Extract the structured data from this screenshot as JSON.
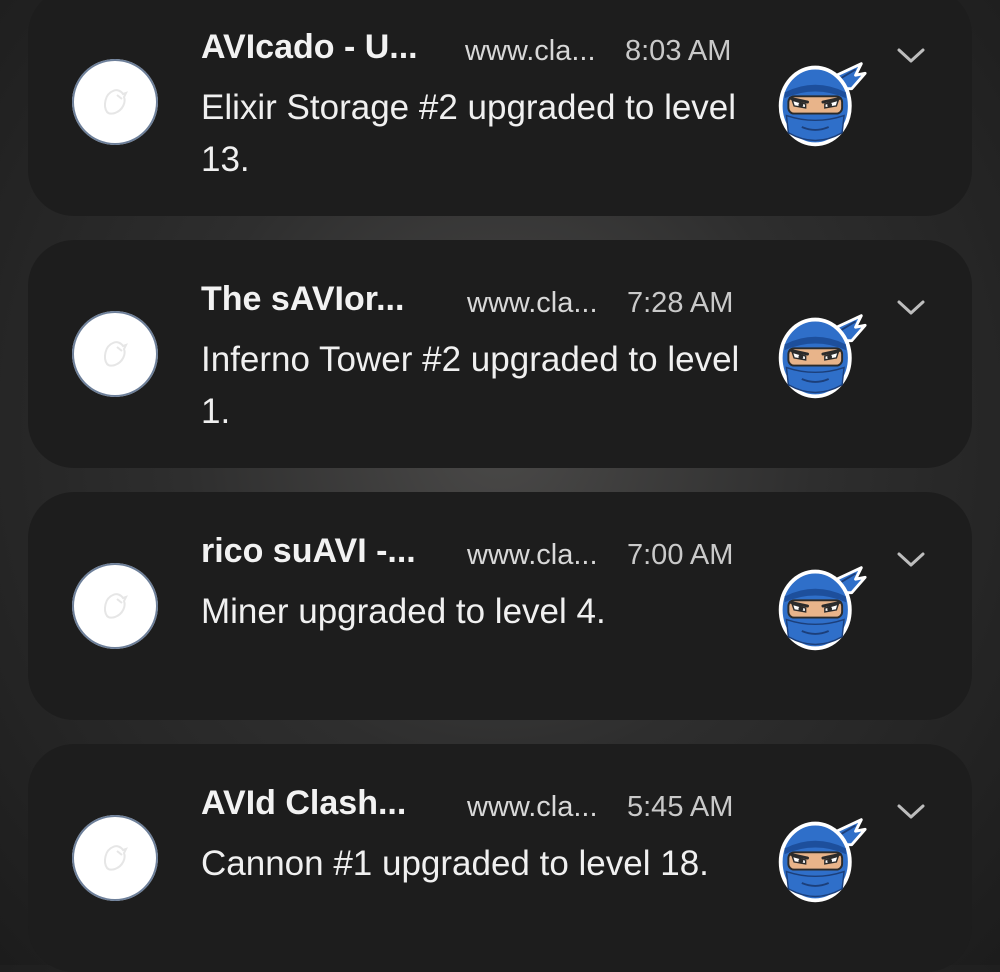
{
  "notifications": [
    {
      "title": "AVIcado - U...",
      "domain": "www.cla...",
      "time": "8:03 AM",
      "message": "Elixir Storage #2 upgraded to level 13.",
      "app_icon": "clash-app-icon",
      "large_icon": "blue-ninja-icon",
      "action_icon": "chevron-down-icon"
    },
    {
      "title": "The sAVIor...",
      "domain": "www.cla...",
      "time": "7:28 AM",
      "message": "Inferno Tower #2 upgraded to level 1.",
      "app_icon": "clash-app-icon",
      "large_icon": "blue-ninja-icon",
      "action_icon": "chevron-down-icon"
    },
    {
      "title": "rico suAVI -...",
      "domain": "www.cla...",
      "time": "7:00 AM",
      "message": "Miner upgraded to level 4.",
      "app_icon": "clash-app-icon",
      "large_icon": "blue-ninja-icon",
      "action_icon": "chevron-down-icon"
    },
    {
      "title": "AVId Clash...",
      "domain": "www.cla...",
      "time": "5:45 AM",
      "message": "Cannon #1 upgraded to level 18.",
      "app_icon": "clash-app-icon",
      "large_icon": "blue-ninja-icon",
      "action_icon": "chevron-down-icon"
    }
  ],
  "colors": {
    "card_background": "#1d1d1d",
    "ninja_blue": "#2f6fc9",
    "text_primary": "#f2f2f2",
    "text_secondary": "#c9c9c9"
  }
}
